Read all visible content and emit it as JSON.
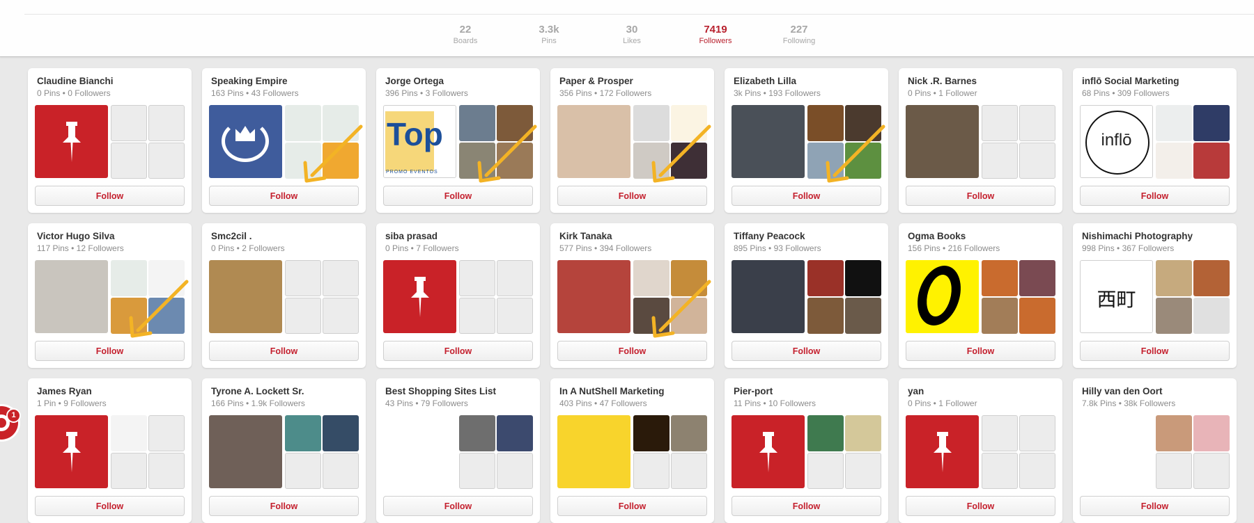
{
  "stats": [
    {
      "value": "22",
      "label": "Boards",
      "active": false
    },
    {
      "value": "3.3k",
      "label": "Pins",
      "active": false
    },
    {
      "value": "30",
      "label": "Likes",
      "active": false
    },
    {
      "value": "7419",
      "label": "Followers",
      "active": true
    },
    {
      "value": "227",
      "label": "Following",
      "active": false
    }
  ],
  "follow_label": "Follow",
  "notification": {
    "count": "1",
    "icon": "pinterest-logo-icon"
  },
  "colors": {
    "accent_red": "#c4202e",
    "pin_red": "#c92228",
    "stat_gray": "#a7a7a7",
    "arrow_orange": "#f3b325"
  },
  "cards": [
    {
      "name": "Claudine Bianchi",
      "meta": "0 Pins • 0 Followers",
      "main": "pin",
      "thumbs": [
        "empty",
        "empty",
        "empty",
        "empty"
      ],
      "arrow": false
    },
    {
      "name": "Speaking Empire",
      "meta": "163 Pins • 43 Followers",
      "main": "crown-laurel",
      "thumbs": [
        "infographic",
        "infographic",
        "infographic",
        "orange"
      ],
      "arrow": true
    },
    {
      "name": "Jorge Ortega",
      "meta": "396 Pins • 3 Followers",
      "main": "top-promo",
      "thumbs": [
        "house",
        "interior",
        "wine",
        "house2"
      ],
      "arrow": true
    },
    {
      "name": "Paper & Prosper",
      "meta": "356 Pins • 172 Followers",
      "main": "portrait-blonde",
      "thumbs": [
        "desk",
        "blog-post",
        "camera",
        "magazine"
      ],
      "arrow": true
    },
    {
      "name": "Elizabeth Lilla",
      "meta": "3k Pins • 193 Followers",
      "main": "baby",
      "thumbs": [
        "floor",
        "coffee",
        "kids",
        "plant"
      ],
      "arrow": true
    },
    {
      "name": "Nick .R. Barnes",
      "meta": "0 Pins • 1 Follower",
      "main": "man-wine",
      "thumbs": [
        "empty",
        "empty",
        "empty",
        "empty"
      ],
      "arrow": false
    },
    {
      "name": "inflō Social Marketing",
      "meta": "68 Pins • 309 Followers",
      "main": "inflo-logo",
      "thumbs": [
        "brain-infographic",
        "cyberman",
        "diagram",
        "youtube"
      ],
      "arrow": false
    },
    {
      "name": "Victor Hugo Silva",
      "meta": "117 Pins • 12 Followers",
      "main": "portrait-man",
      "thumbs": [
        "infographic",
        "document",
        "orange-grid",
        "blue-diagram"
      ],
      "arrow": true
    },
    {
      "name": "Smc2cil .",
      "meta": "0 Pins • 2 Followers",
      "main": "wood",
      "thumbs": [
        "empty",
        "empty",
        "empty",
        "empty"
      ],
      "arrow": false
    },
    {
      "name": "siba prasad",
      "meta": "0 Pins • 7 Followers",
      "main": "pin",
      "thumbs": [
        "empty",
        "empty",
        "empty",
        "empty"
      ],
      "arrow": false
    },
    {
      "name": "Kirk Tanaka",
      "meta": "577 Pins • 394 Followers",
      "main": "portrait-red",
      "thumbs": [
        "bulldog",
        "dog",
        "bulldog2",
        "bulldog3"
      ],
      "arrow": true
    },
    {
      "name": "Tiffany Peacock",
      "meta": "895 Pins • 93 Followers",
      "main": "couple",
      "thumbs": [
        "quote-red",
        "quote-black",
        "interior",
        "interior2"
      ],
      "arrow": false
    },
    {
      "name": "Ogma Books",
      "meta": "156 Pins • 216 Followers",
      "main": "ogma-logo",
      "thumbs": [
        "book-cover",
        "poem-cover",
        "gladiators",
        "book-cover"
      ],
      "arrow": false
    },
    {
      "name": "Nishimachi Photography",
      "meta": "998 Pins • 367 Followers",
      "main": "nishimachi-logo",
      "thumbs": [
        "photo",
        "racecar",
        "photo2",
        "photo-bw"
      ],
      "arrow": false
    },
    {
      "name": "James Ryan",
      "meta": "1 Pin • 9 Followers",
      "main": "pin",
      "thumbs": [
        "document",
        "empty",
        "empty",
        "empty"
      ],
      "arrow": false
    },
    {
      "name": "Tyrone A. Lockett Sr.",
      "meta": "166 Pins • 1.9k Followers",
      "main": "portrait-dark",
      "thumbs": [
        "car-teal",
        "car-blue",
        "empty",
        "empty"
      ],
      "arrow": false
    },
    {
      "name": "Best Shopping Sites List",
      "meta": "43 Pins • 79 Followers",
      "main": "shopping-cart",
      "thumbs": [
        "keyboard",
        "laptop",
        "empty",
        "empty"
      ],
      "arrow": false
    },
    {
      "name": "In A NutShell Marketing",
      "meta": "403 Pins • 47 Followers",
      "main": "sun-yellow",
      "thumbs": [
        "sunset",
        "hands",
        "empty",
        "empty"
      ],
      "arrow": false
    },
    {
      "name": "Pier-port",
      "meta": "11 Pins • 10 Followers",
      "main": "pin",
      "thumbs": [
        "tent",
        "shelf",
        "empty",
        "empty"
      ],
      "arrow": false
    },
    {
      "name": "yan",
      "meta": "0 Pins • 1 Follower",
      "main": "pin",
      "thumbs": [
        "empty",
        "empty",
        "empty",
        "empty"
      ],
      "arrow": false
    },
    {
      "name": "Hilly van den Oort",
      "meta": "7.8k Pins • 38k Followers",
      "main": "green-logo",
      "thumbs": [
        "fruit-dip",
        "strawberry",
        "empty",
        "empty"
      ],
      "arrow": false
    }
  ]
}
